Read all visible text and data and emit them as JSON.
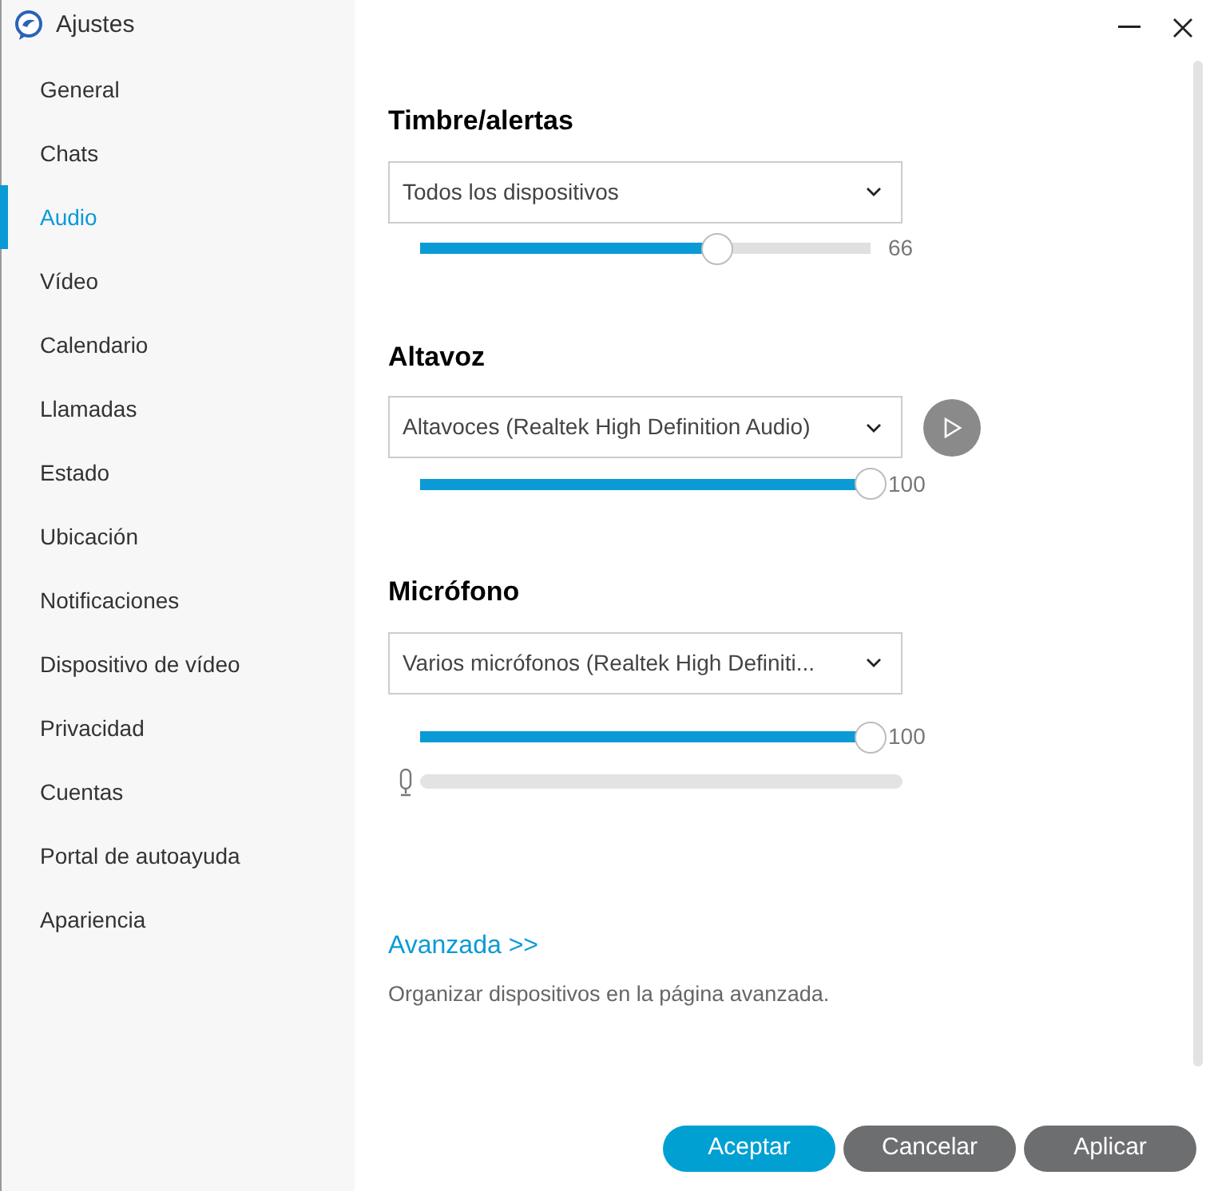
{
  "window": {
    "title": "Ajustes"
  },
  "sidebar": {
    "items": [
      {
        "label": "General",
        "selected": false
      },
      {
        "label": "Chats",
        "selected": false
      },
      {
        "label": "Audio",
        "selected": true
      },
      {
        "label": "Vídeo",
        "selected": false
      },
      {
        "label": "Calendario",
        "selected": false
      },
      {
        "label": "Llamadas",
        "selected": false
      },
      {
        "label": "Estado",
        "selected": false
      },
      {
        "label": "Ubicación",
        "selected": false
      },
      {
        "label": "Notificaciones",
        "selected": false
      },
      {
        "label": "Dispositivo de vídeo",
        "selected": false
      },
      {
        "label": "Privacidad",
        "selected": false
      },
      {
        "label": "Cuentas",
        "selected": false
      },
      {
        "label": "Portal de autoayuda",
        "selected": false
      },
      {
        "label": "Apariencia",
        "selected": false
      }
    ]
  },
  "sections": [
    {
      "title": "Timbre/alertas",
      "device": "Todos los dispositivos",
      "play_button": false,
      "level": 0.66,
      "reading": "66"
    },
    {
      "title": "Altavoz",
      "device": "Altavoces (Realtek High Definition Audio)",
      "play_button": true,
      "level": 1,
      "reading": "100"
    },
    {
      "title": "Micrófono",
      "device": "Varios micrófonos (Realtek High Definiti...",
      "play_button": false,
      "level": 1,
      "reading": "100",
      "input_meter": {
        "level": 0
      }
    }
  ],
  "advanced": {
    "link": "Avanzada >>",
    "description": "Organizar dispositivos en la página avanzada."
  },
  "buttons": [
    {
      "label": "Aceptar",
      "kind": "primary"
    },
    {
      "label": "Cancelar",
      "kind": "secondary"
    },
    {
      "label": "Aplicar",
      "kind": "secondary"
    }
  ]
}
